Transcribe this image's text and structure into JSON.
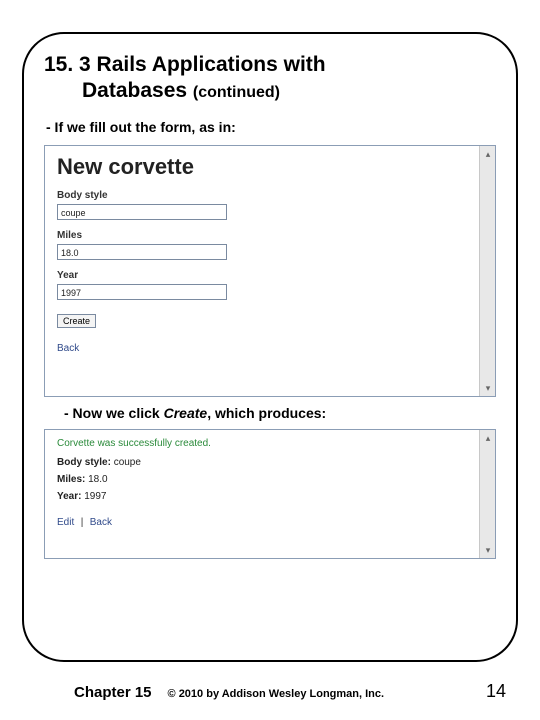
{
  "title": {
    "main": "15. 3 Rails Applications with",
    "line2": "Databases",
    "cont": "(continued)"
  },
  "bullets": {
    "fill_form": "- If we fill out the form, as in:",
    "click_create_a": "- Now we click ",
    "click_create_b": "Create",
    "click_create_c": ", which produces:"
  },
  "form": {
    "heading": "New corvette",
    "labels": {
      "body_style": "Body style",
      "miles": "Miles",
      "year": "Year"
    },
    "values": {
      "body_style": "coupe",
      "miles": "18.0",
      "year": "1997"
    },
    "create_button": "Create",
    "back_link": "Back"
  },
  "result": {
    "flash": "Corvette was successfully created.",
    "body_style_label": "Body style:",
    "body_style_value": "coupe",
    "miles_label": "Miles:",
    "miles_value": "18.0",
    "year_label": "Year:",
    "year_value": "1997",
    "edit_link": "Edit",
    "back_link": "Back"
  },
  "footer": {
    "chapter": "Chapter 15",
    "copyright": "© 2010 by Addison Wesley Longman, Inc.",
    "page": "14"
  }
}
